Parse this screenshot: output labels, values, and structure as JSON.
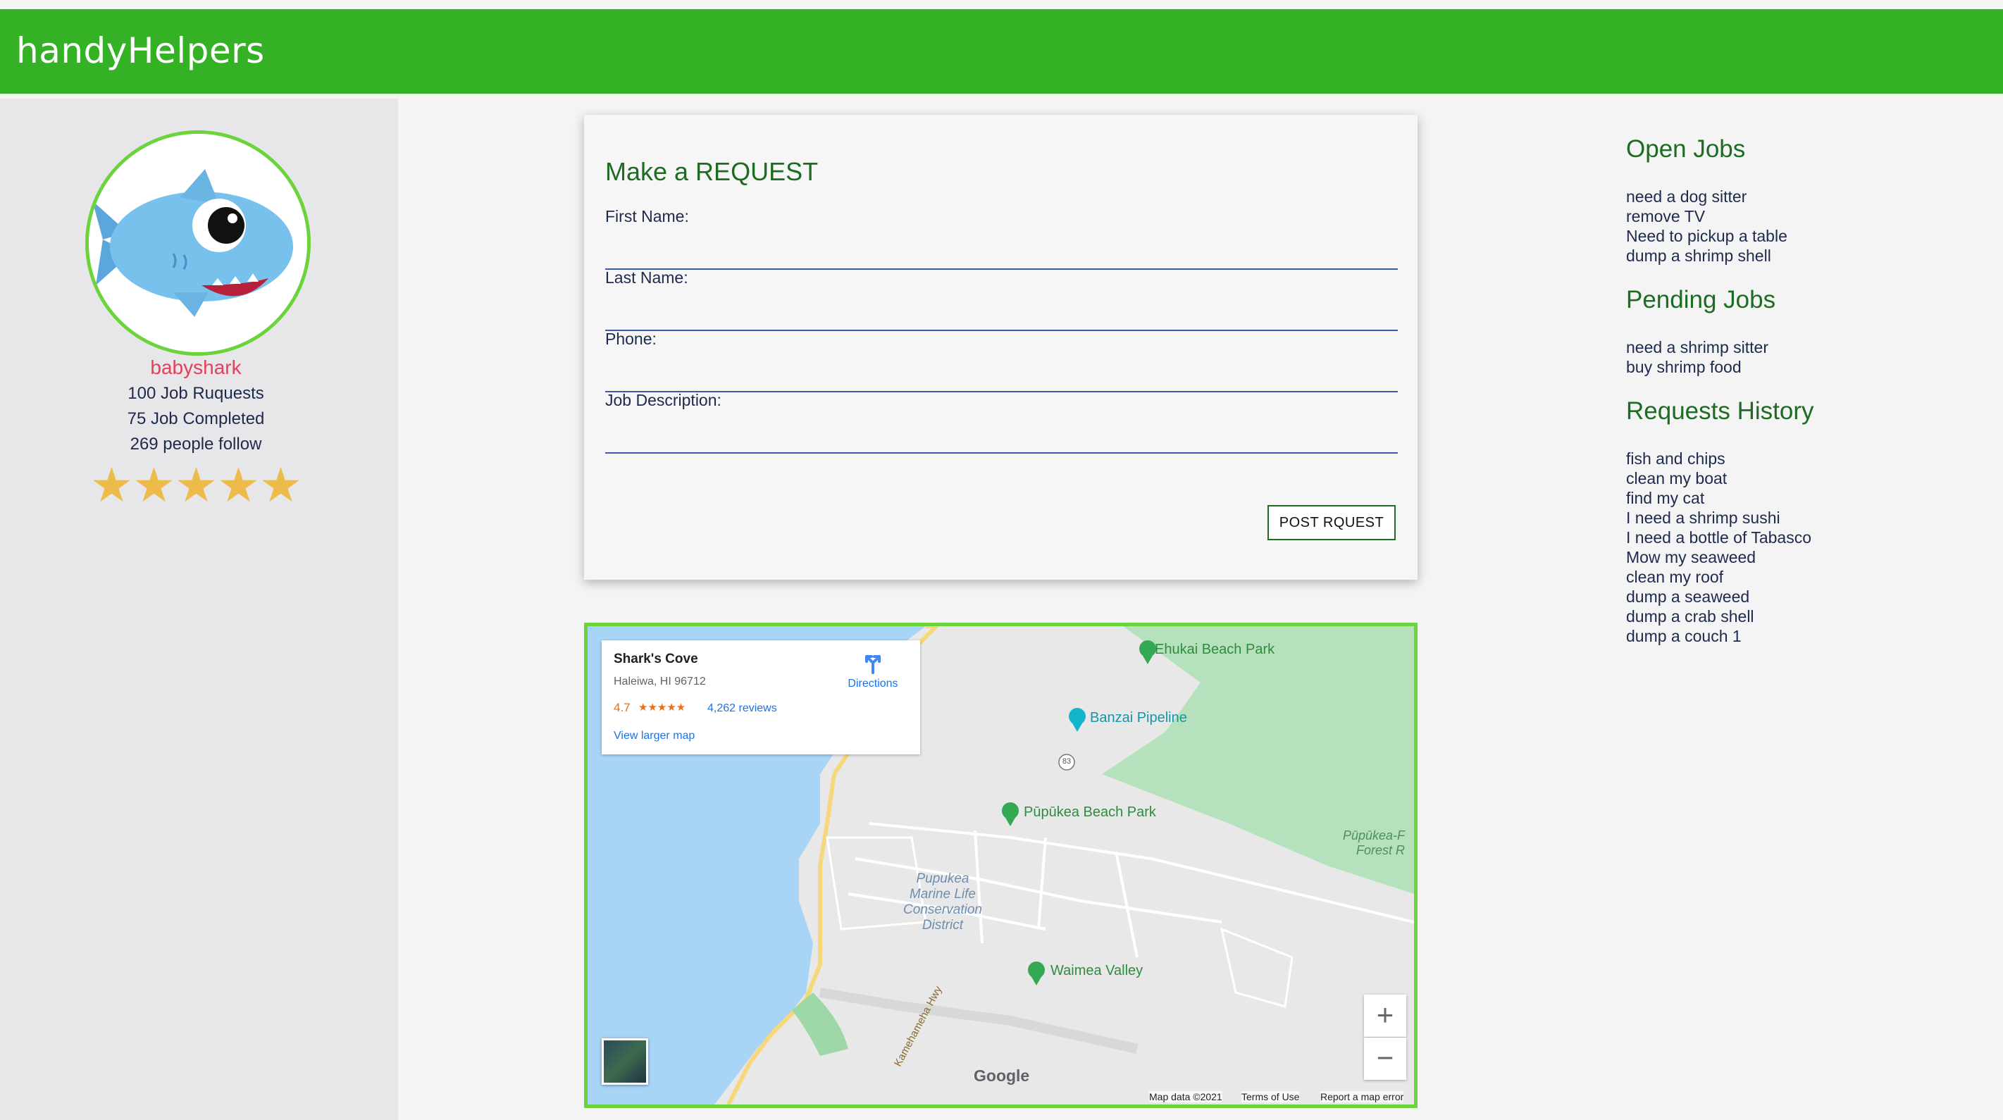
{
  "app": {
    "brand": "handyHelpers"
  },
  "profile": {
    "username": "babyshark",
    "stats": [
      "100 Job Ruquests",
      "75 Job Completed",
      "269 people follow"
    ],
    "rating": 5,
    "rating_max": 5
  },
  "request_form": {
    "title": "Make a REQUEST",
    "fields": [
      {
        "label": "First Name:",
        "value": ""
      },
      {
        "label": "Last Name:",
        "value": ""
      },
      {
        "label": "Phone:",
        "value": ""
      },
      {
        "label": "Job Description:",
        "value": ""
      }
    ],
    "submit_label": "POST RQUEST"
  },
  "map": {
    "place_name": "Shark's Cove",
    "address": "Haleiwa, HI 96712",
    "rating": "4.7",
    "stars_text": "★★★★★",
    "reviews": "4,262 reviews",
    "view_larger": "View larger map",
    "directions": "Directions",
    "pois": [
      "Ehukai Beach Park",
      "Banzai Pipeline",
      "Pūpūkea Beach Park",
      "Waimea Valley"
    ],
    "highway_shield": "83",
    "area_labels": [
      "Pupukea",
      "Marine Life",
      "Conservation",
      "District"
    ],
    "forest_labels": [
      "Pūpūkea-F",
      "Forest R"
    ],
    "road_label": "Kamehameha Hwy",
    "google": "Google",
    "footer": [
      "Map data ©2021",
      "Terms of Use",
      "Report a map error"
    ],
    "zoom_in": "+",
    "zoom_out": "−"
  },
  "jobs": {
    "open_title": "Open Jobs",
    "open": [
      "need a dog sitter",
      "remove TV",
      "Need to pickup a table",
      "dump a shrimp shell"
    ],
    "pending_title": "Pending Jobs",
    "pending": [
      "need a shrimp sitter",
      "buy shrimp food"
    ],
    "history_title": "Requests History",
    "history": [
      "fish and chips",
      "clean my boat",
      "find my cat",
      "I need a shrimp sushi",
      "I need a bottle of Tabasco",
      "Mow my seaweed",
      "clean my roof",
      "dump a seaweed",
      "dump a crab shell",
      "dump a couch 1"
    ]
  },
  "colors": {
    "header": "#35b125",
    "accent_green": "#1e6b23",
    "username": "#e2405b",
    "star": "#edbb4a",
    "map_border": "#6ad43a"
  }
}
